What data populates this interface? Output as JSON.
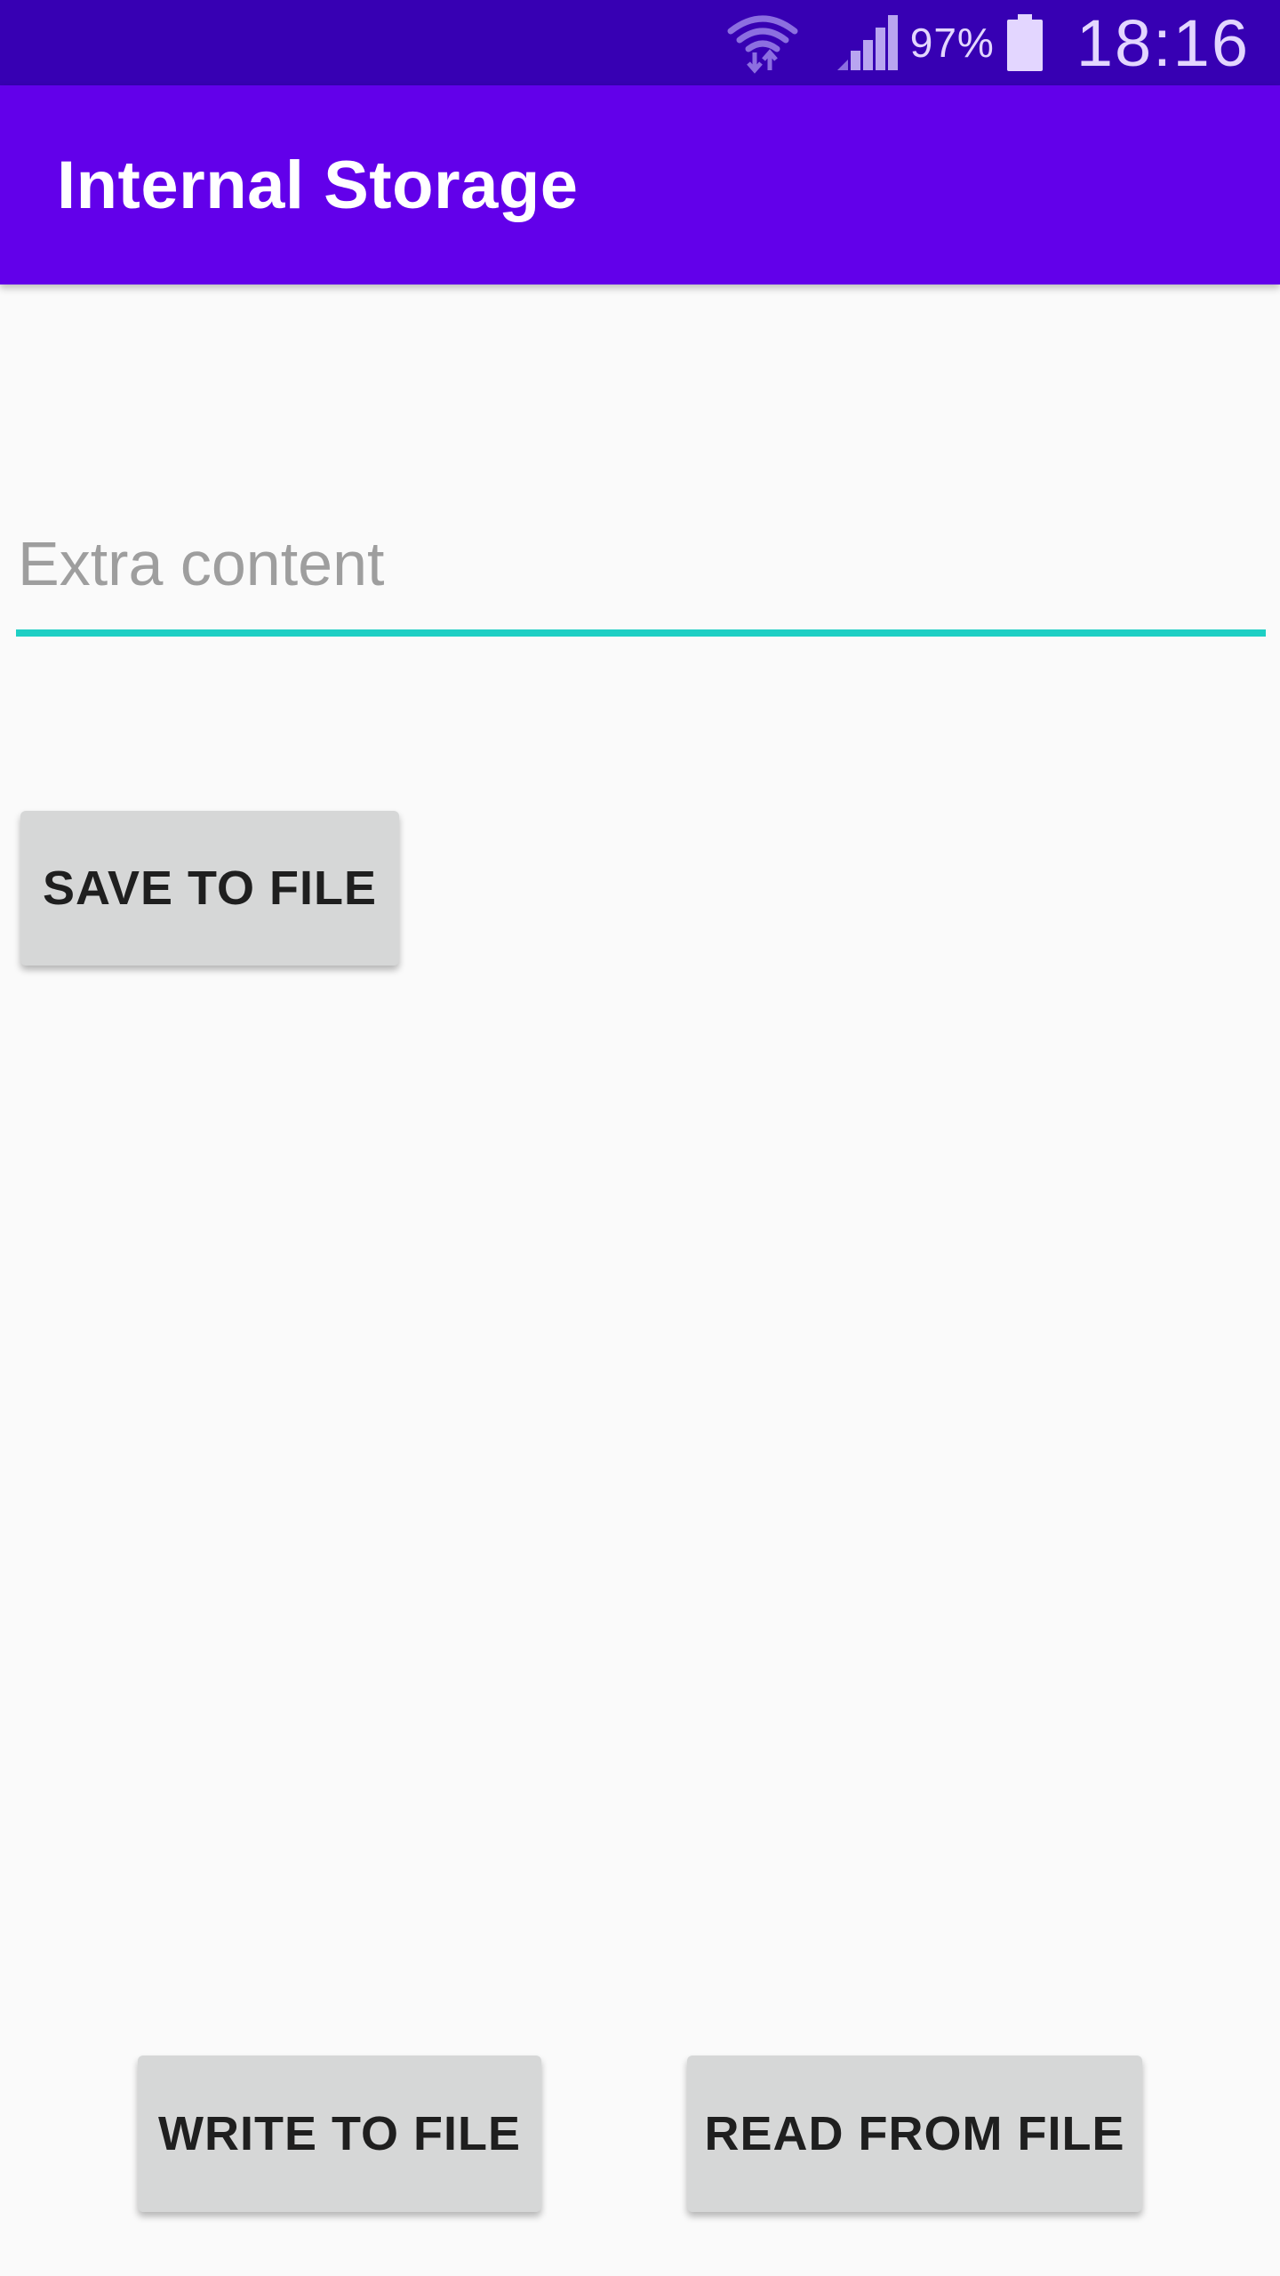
{
  "status_bar": {
    "wifi_icon": "wifi-icon",
    "signal_icon": "cell-signal-icon",
    "battery_percent": "97%",
    "battery_icon": "battery-icon",
    "time": "18:16"
  },
  "app_bar": {
    "title": "Internal Storage",
    "color": "#6200ea"
  },
  "edit_field": {
    "value": "",
    "placeholder": "Extra content",
    "underline_color": "#1ecfc4"
  },
  "buttons": {
    "save_label": "SAVE TO FILE",
    "write_label": "WRITE TO FILE",
    "read_label": "READ FROM FILE"
  },
  "colors": {
    "status_bar": "#3700b3",
    "background": "#fafafa",
    "button": "#d6d7d7"
  }
}
